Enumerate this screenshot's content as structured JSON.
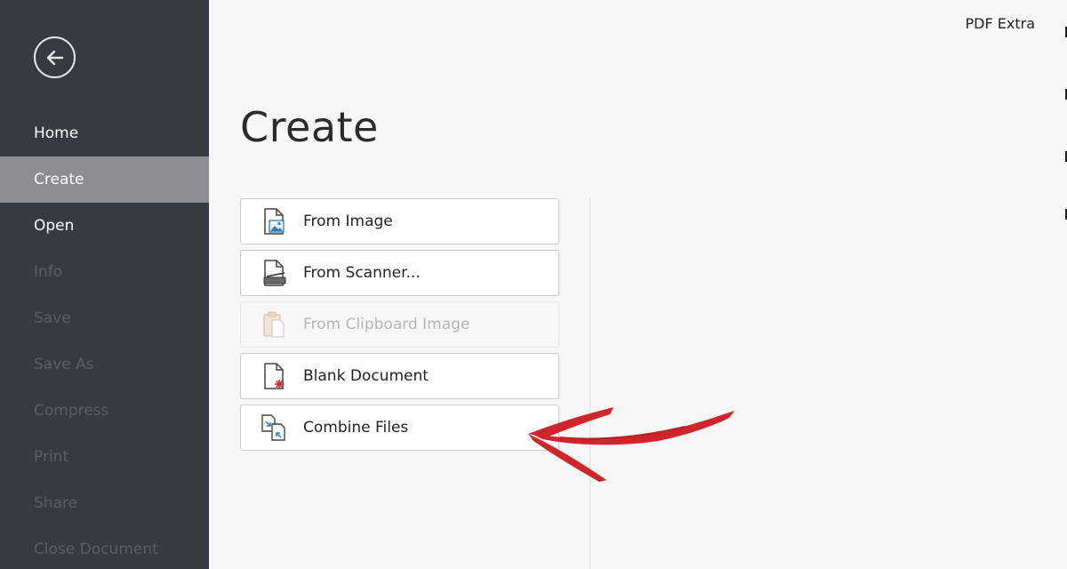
{
  "app": {
    "title": "PDF Extra"
  },
  "sidebar": {
    "items": [
      {
        "label": "Home",
        "state": "normal"
      },
      {
        "label": "Create",
        "state": "active"
      },
      {
        "label": "Open",
        "state": "normal"
      },
      {
        "label": "Info",
        "state": "disabled"
      },
      {
        "label": "Save",
        "state": "disabled"
      },
      {
        "label": "Save As",
        "state": "disabled"
      },
      {
        "label": "Compress",
        "state": "disabled"
      },
      {
        "label": "Print",
        "state": "disabled"
      },
      {
        "label": "Share",
        "state": "disabled"
      },
      {
        "label": "Close Document",
        "state": "disabled"
      }
    ]
  },
  "main": {
    "title": "Create",
    "options": [
      {
        "label": "From Image",
        "icon": "image-file-icon",
        "enabled": true
      },
      {
        "label": "From Scanner...",
        "icon": "scanner-icon",
        "enabled": true
      },
      {
        "label": "From Clipboard Image",
        "icon": "clipboard-icon",
        "enabled": false
      },
      {
        "label": "Blank Document",
        "icon": "blank-document-icon",
        "enabled": true
      },
      {
        "label": "Combine Files",
        "icon": "combine-files-icon",
        "enabled": true
      }
    ]
  },
  "colors": {
    "sidebar_bg": "#363b42",
    "sidebar_active": "#8a8d91",
    "sidebar_disabled_text": "#5a6068",
    "content_bg": "#f7f7f7",
    "annotation_arrow": "#d0262b"
  }
}
